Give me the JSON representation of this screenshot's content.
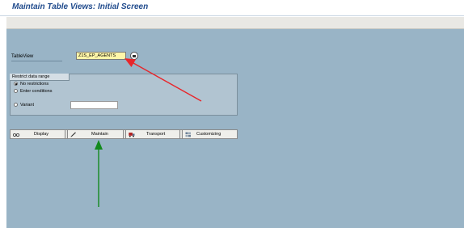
{
  "window": {
    "title": "Maintain Table Views: Initial Screen"
  },
  "form": {
    "tableview_label": "TableView",
    "tableview_value": "Z1S_EP_AGENTS"
  },
  "restrict": {
    "group_title": "Restrict data range",
    "options": [
      {
        "label": "No restrictions",
        "selected": true
      },
      {
        "label": "Enter conditions",
        "selected": false
      },
      {
        "label": "Variant",
        "selected": false
      }
    ],
    "variant_value": ""
  },
  "actions": {
    "display_label": "Display",
    "maintain_label": "Maintain",
    "transport_label": "Transport",
    "customizing_label": "Customizing"
  },
  "annotations": {
    "red_arrow_color": "#e8262b",
    "green_arrow_color": "#138a1d"
  },
  "colors": {
    "screen_background": "#99b4c6",
    "title_color": "#1f4a8c",
    "input_highlight": "#fff6a8"
  }
}
